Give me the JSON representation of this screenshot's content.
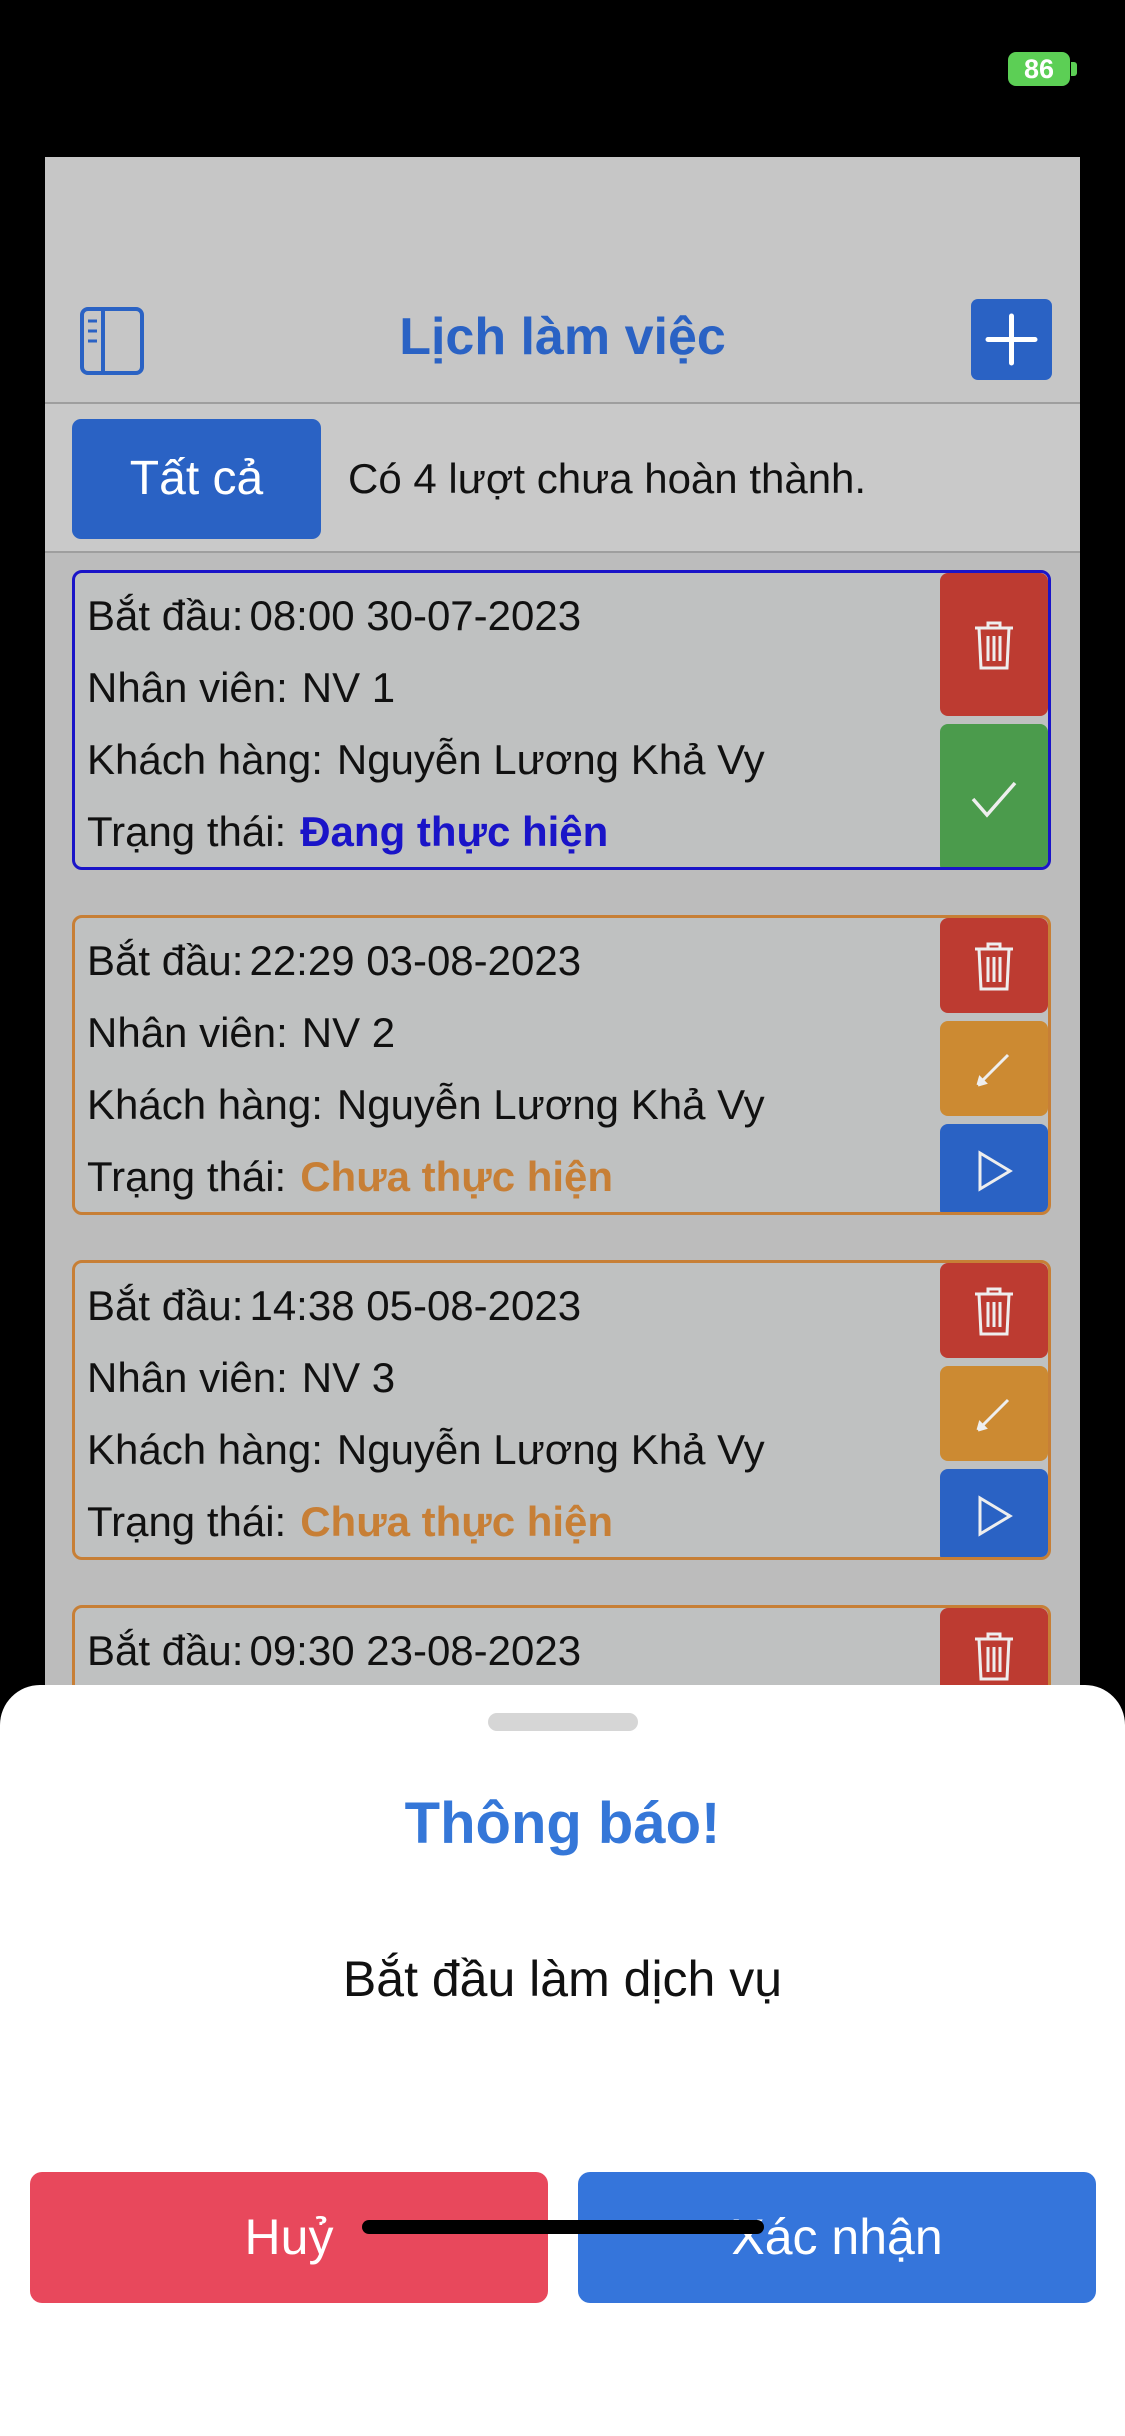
{
  "status_bar": {
    "battery": "86"
  },
  "header": {
    "title": "Lịch làm việc"
  },
  "filter": {
    "all_label": "Tất cả",
    "pending_text": "Có 4 lượt chưa hoàn thành."
  },
  "labels": {
    "start": "Bắt đầu:",
    "employee": "Nhân viên:",
    "customer": "Khách hàng:",
    "status": "Trạng thái:"
  },
  "schedule": [
    {
      "start": "08:00 30-07-2023",
      "employee": "NV 1",
      "customer": "Nguyễn Lương Khả Vy",
      "status": "Đang thực hiện",
      "actions": [
        "delete-icon",
        "check-icon"
      ]
    },
    {
      "start": "22:29 03-08-2023",
      "employee": "NV 2",
      "customer": "Nguyễn Lương Khả Vy",
      "status": "Chưa thực hiện",
      "actions": [
        "delete-icon",
        "pencil-icon",
        "play-icon"
      ]
    },
    {
      "start": "14:38 05-08-2023",
      "employee": "NV 3",
      "customer": "Nguyễn Lương Khả Vy",
      "status": "Chưa thực hiện",
      "actions": [
        "delete-icon",
        "pencil-icon",
        "play-icon"
      ]
    },
    {
      "start": "09:30 23-08-2023",
      "actions": [
        "delete-icon"
      ]
    }
  ],
  "dialog": {
    "title": "Thông báo!",
    "message": "Bắt đầu làm dịch vụ",
    "cancel_label": "Huỷ",
    "confirm_label": "Xác nhận"
  },
  "colors": {
    "primary": "#2a62c4",
    "in_progress": "#1a14c8",
    "not_started": "#c77f36",
    "delete": "#bd3b31",
    "done": "#4b9b4c",
    "cancel": "#e8485c",
    "confirm": "#3575db"
  }
}
